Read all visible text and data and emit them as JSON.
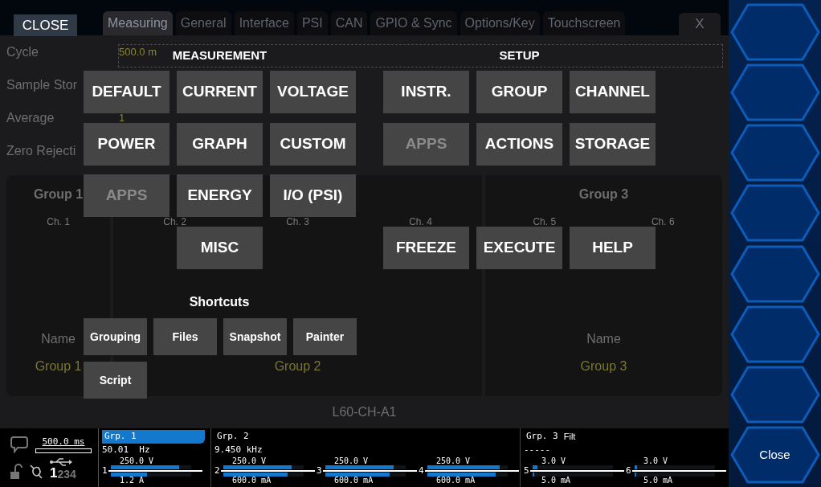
{
  "close_overlay": {
    "label": "CLOSE"
  },
  "tabs": [
    {
      "label": "Measuring",
      "selected": true
    },
    {
      "label": "General",
      "selected": false
    },
    {
      "label": "Interface",
      "selected": false
    },
    {
      "label": "PSI",
      "selected": false
    },
    {
      "label": "CAN",
      "selected": false
    },
    {
      "label": "GPIO & Sync",
      "selected": false
    },
    {
      "label": "Options/Key",
      "selected": false
    },
    {
      "label": "Touchscreen",
      "selected": false
    }
  ],
  "window_close": "X",
  "settings": [
    {
      "label": "Cycle",
      "value": "500.0 m"
    },
    {
      "label": "Sample Stor"
    },
    {
      "label": "Average",
      "value": "1"
    },
    {
      "label": "Zero Rejecti"
    }
  ],
  "groups_panel": {
    "columns": [
      {
        "title": "Group 1",
        "channels": [
          "Ch. 1"
        ],
        "name_label": "Name",
        "name_value": "Group 1"
      },
      {
        "channels": [
          "Ch. 2",
          "Ch. 3",
          "Ch. 4"
        ],
        "name_value": "Group 2"
      },
      {
        "title": "Group 3",
        "channels": [
          "Ch. 5",
          "Ch. 6"
        ],
        "name_label": "Name",
        "name_value": "Group 3"
      }
    ],
    "footer": "L60-CH-A1"
  },
  "menu": {
    "measurement": {
      "title": "MEASUREMENT",
      "rows": [
        [
          {
            "label": "DEFAULT",
            "disabled": false
          },
          {
            "label": "CURRENT",
            "disabled": false
          },
          {
            "label": "VOLTAGE",
            "disabled": false
          }
        ],
        [
          {
            "label": "POWER",
            "disabled": false
          },
          {
            "label": "GRAPH",
            "disabled": false
          },
          {
            "label": "CUSTOM",
            "disabled": false
          }
        ],
        [
          {
            "label": "APPS",
            "disabled": true
          },
          {
            "label": "ENERGY",
            "disabled": false
          },
          {
            "label": "I/O (PSI)",
            "disabled": false
          }
        ],
        [
          "",
          {
            "label": "MISC",
            "disabled": false
          }
        ]
      ]
    },
    "setup": {
      "title": "SETUP",
      "rows": [
        [
          {
            "label": "INSTR.",
            "disabled": false
          },
          {
            "label": "GROUP",
            "disabled": false
          },
          {
            "label": "CHANNEL",
            "disabled": false
          }
        ],
        [
          {
            "label": "APPS",
            "disabled": true
          },
          {
            "label": "ACTIONS",
            "disabled": false
          },
          {
            "label": "STORAGE",
            "disabled": false
          }
        ],
        [
          "",
          "",
          ""
        ],
        [
          {
            "label": "FREEZE",
            "disabled": false
          },
          {
            "label": "EXECUTE",
            "disabled": false
          },
          {
            "label": "HELP",
            "disabled": false
          }
        ]
      ]
    },
    "shortcuts": {
      "title": "Shortcuts",
      "items": [
        "Grouping",
        "Files",
        "Snapshot",
        "Painter",
        "Script"
      ]
    }
  },
  "status_bar": {
    "cycle": {
      "text": "500.0 ms",
      "level": 0
    },
    "usb_ports": [
      {
        "label": "1",
        "active": true
      },
      {
        "label": "2",
        "active": false
      },
      {
        "label": "3",
        "active": false
      },
      {
        "label": "4",
        "active": false
      }
    ],
    "groups": [
      {
        "label": "Grp. 1",
        "selected": true,
        "frequency": "50.01  Hz",
        "channels": [
          {
            "number": "1",
            "voltage": {
              "text": "250.0 V",
              "level": 0.85
            },
            "current": {
              "text": "1.2 A",
              "level": 0.45
            }
          }
        ]
      },
      {
        "label": "Grp. 2",
        "selected": false,
        "frequency": "9.450 kHz",
        "channels": [
          {
            "number": "2",
            "voltage": {
              "text": "250.0 V",
              "level": 0.85
            },
            "current": {
              "text": "600.0 mA",
              "level": 0.8
            }
          },
          {
            "number": "3",
            "voltage": {
              "text": "250.0 V",
              "level": 0.85
            },
            "current": {
              "text": "600.0 mA",
              "level": 0.8
            }
          },
          {
            "number": "4",
            "voltage": {
              "text": "250.0 V",
              "level": 0.9
            },
            "current": {
              "text": "600.0 mA",
              "level": 0.85
            }
          }
        ]
      },
      {
        "label": "Grp. 3",
        "selected": false,
        "filter": "Filt",
        "frequency": "-----",
        "channels": [
          {
            "number": "5",
            "voltage": {
              "text": "3.0 V",
              "level": 0.06
            },
            "current": {
              "text": "5.0 mA",
              "level": 0.02
            }
          },
          {
            "number": "6",
            "voltage": {
              "text": "3.0 V",
              "level": 0.03
            },
            "current": {
              "text": "5.0 mA",
              "level": 0.02
            }
          }
        ]
      }
    ]
  },
  "softkeys": {
    "close": "Close"
  }
}
